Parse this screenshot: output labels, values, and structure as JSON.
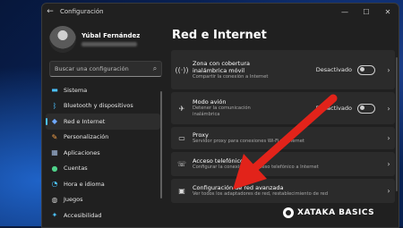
{
  "window": {
    "title": "Configuración",
    "back_icon": "back-arrow-icon"
  },
  "window_controls": [
    "minimize",
    "maximize",
    "close"
  ],
  "profile": {
    "name": "Yúbal Fernández"
  },
  "search": {
    "placeholder": "Buscar una configuración"
  },
  "sidebar": {
    "items": [
      {
        "label": "Sistema",
        "icon": "system-icon",
        "color": "#4cc2ff",
        "active": false
      },
      {
        "label": "Bluetooth y dispositivos",
        "icon": "bluetooth-icon",
        "color": "#4cc2ff",
        "active": false
      },
      {
        "label": "Red e Internet",
        "icon": "wifi-icon",
        "color": "#6fa8ff",
        "active": true
      },
      {
        "label": "Personalización",
        "icon": "brush-icon",
        "color": "#f7a24a",
        "active": false
      },
      {
        "label": "Aplicaciones",
        "icon": "apps-icon",
        "color": "#9fb6d8",
        "active": false
      },
      {
        "label": "Cuentas",
        "icon": "accounts-icon",
        "color": "#4fd28a",
        "active": false
      },
      {
        "label": "Hora e idioma",
        "icon": "time-language-icon",
        "color": "#4cc2ff",
        "active": false
      },
      {
        "label": "Juegos",
        "icon": "gaming-icon",
        "color": "#cfcfcf",
        "active": false
      },
      {
        "label": "Accesibilidad",
        "icon": "accessibility-icon",
        "color": "#4cc2ff",
        "active": false
      }
    ]
  },
  "main": {
    "heading": "Red e Internet",
    "cards": [
      {
        "title": "Zona con cobertura inalámbrica móvil",
        "desc": "Compartir la conexión a Internet",
        "status": "Desactivado",
        "toggle": false,
        "icon": "hotspot-icon"
      },
      {
        "title": "Modo avión",
        "desc": "Detener la comunicación inalámbrica",
        "status": "Desactivado",
        "toggle": false,
        "icon": "airplane-icon"
      },
      {
        "title": "Proxy",
        "desc": "Servidor proxy para conexiones Wi-Fi y Ethernet",
        "icon": "proxy-icon"
      },
      {
        "title": "Acceso telefónico",
        "desc": "Configurar la conexión de acceso telefónico a Internet",
        "icon": "dialup-icon"
      },
      {
        "title": "Configuración de red avanzada",
        "desc": "Ver todos los adaptadores de red, restablecimiento de red",
        "icon": "advanced-network-icon"
      }
    ]
  },
  "annotation": {
    "color": "#e2231a",
    "icon": "red-arrow-icon"
  },
  "watermark": {
    "text": "XATAKA BASICS"
  }
}
